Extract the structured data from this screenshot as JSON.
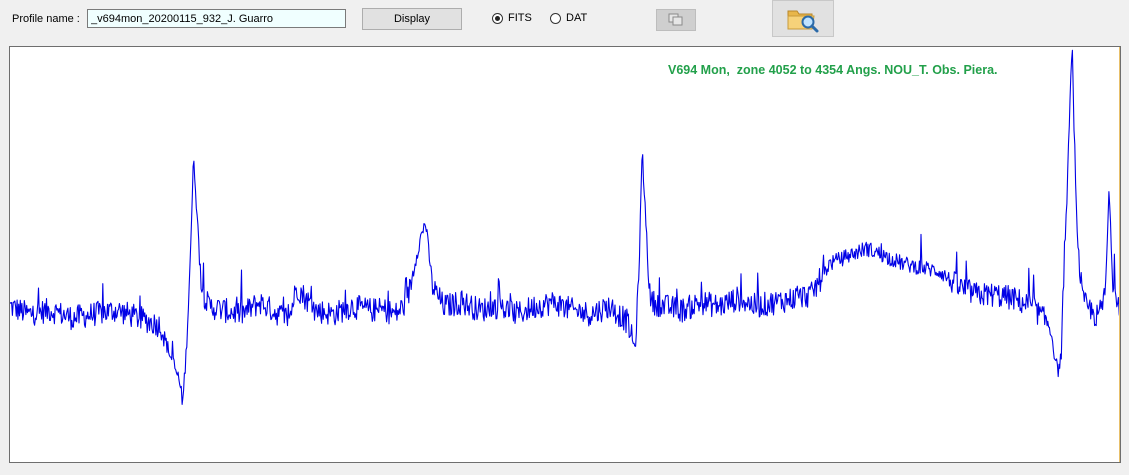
{
  "toolbar": {
    "profile_label": "Profile name :",
    "profile_value": "_v694mon_20200115_932_J. Guarro",
    "display_label": "Display",
    "fits_label": "FITS",
    "dat_label": "DAT",
    "format_selected": "FITS"
  },
  "plot": {
    "title": "V694 Mon,  zone 4052 to 4354 Angs. NOU_T. Obs. Piera."
  },
  "colors": {
    "line": "#0000e6",
    "title": "#22a04a"
  },
  "chart_data": {
    "type": "line",
    "title": "V694 Mon,  zone 4052 to 4354 Angs. NOU_T. Obs. Piera.",
    "xlabel": "",
    "ylabel": "",
    "xlim": [
      4052,
      4354
    ],
    "ylim": [
      0,
      100
    ],
    "grid": false,
    "series": [
      {
        "x": [
          4052,
          4057,
          4063,
          4069,
          4075,
          4081,
          4087,
          4093,
          4095,
          4098,
          4099,
          4100,
          4101,
          4102,
          4103,
          4104,
          4106,
          4110,
          4115,
          4120,
          4125,
          4128,
          4130,
          4135,
          4140,
          4145,
          4150,
          4154,
          4157,
          4160,
          4163,
          4165,
          4167,
          4170,
          4175,
          4180,
          4185,
          4190,
          4195,
          4200,
          4205,
          4210,
          4215,
          4220,
          4222,
          4223,
          4224,
          4225,
          4226,
          4227,
          4230,
          4235,
          4240,
          4245,
          4250,
          4255,
          4260,
          4265,
          4270,
          4275,
          4280,
          4285,
          4290,
          4295,
          4300,
          4305,
          4310,
          4315,
          4320,
          4325,
          4330,
          4335,
          4337,
          4338,
          4339,
          4340,
          4341,
          4342,
          4343,
          4344,
          4346,
          4348,
          4350,
          4351,
          4352,
          4354
        ],
        "y": [
          33,
          31,
          32,
          30,
          31,
          32,
          30,
          28,
          22,
          14,
          8,
          22,
          45,
          72,
          55,
          38,
          33,
          32,
          31,
          34,
          31,
          30,
          38,
          32,
          31,
          33,
          32,
          32,
          31,
          34,
          48,
          55,
          38,
          33,
          34,
          32,
          33,
          31,
          33,
          34,
          32,
          31,
          33,
          29,
          22,
          38,
          73,
          55,
          36,
          34,
          33,
          32,
          34,
          33,
          35,
          33,
          34,
          35,
          36,
          44,
          46,
          48,
          46,
          44,
          43,
          42,
          38,
          36,
          36,
          35,
          33,
          28,
          16,
          20,
          45,
          75,
          100,
          60,
          42,
          34,
          32,
          30,
          36,
          62,
          40,
          33
        ]
      }
    ]
  }
}
